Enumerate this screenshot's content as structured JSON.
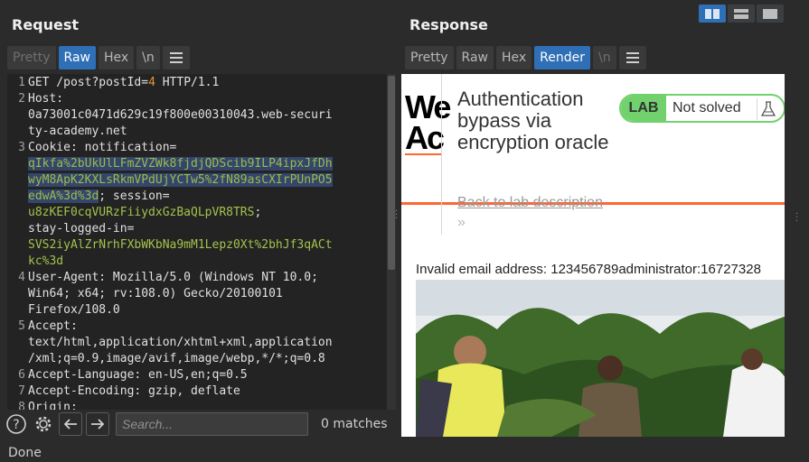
{
  "request": {
    "title": "Request",
    "tabs": [
      {
        "label": "Pretty"
      },
      {
        "label": "Raw"
      },
      {
        "label": "Hex"
      },
      {
        "label": "\\n"
      }
    ],
    "lines": [
      {
        "num": "1",
        "segs": [
          {
            "t": "GET /post?postId=",
            "c": "c-white"
          },
          {
            "t": "4",
            "c": "c-orange"
          },
          {
            "t": " HTTP/1.1",
            "c": "c-white"
          }
        ]
      },
      {
        "num": "2",
        "segs": [
          {
            "t": "Host:",
            "c": "c-white"
          }
        ]
      },
      {
        "num": "",
        "segs": [
          {
            "t": "0a73001c0471d629c19f800e00310043.web-securi",
            "c": "c-white"
          }
        ]
      },
      {
        "num": "",
        "segs": [
          {
            "t": "ty-academy.net",
            "c": "c-white"
          }
        ]
      },
      {
        "num": "3",
        "segs": [
          {
            "t": "Cookie: notification=",
            "c": "c-white"
          }
        ]
      },
      {
        "num": "",
        "segs": [
          {
            "t": "qIkfa%2bUkUlLFmZVZWk8fjdjQDScib9ILP4ipxJfDh",
            "c": "c-sel"
          }
        ]
      },
      {
        "num": "",
        "segs": [
          {
            "t": "wyM8ApK2KXLsRkmVPdUjYCTw5%2fN89asCXIrPUnPO5",
            "c": "c-sel"
          }
        ]
      },
      {
        "num": "",
        "segs": [
          {
            "t": "edwA%3d%3d",
            "c": "c-sel"
          },
          {
            "t": "; session=",
            "c": "c-white"
          }
        ]
      },
      {
        "num": "",
        "segs": [
          {
            "t": "u8zKEF0cqVURzFiiydxGzBaQLpVR8TRS",
            "c": "c-green"
          },
          {
            "t": ";",
            "c": "c-white"
          }
        ]
      },
      {
        "num": "",
        "segs": [
          {
            "t": "stay-logged-in=",
            "c": "c-white"
          }
        ]
      },
      {
        "num": "",
        "segs": [
          {
            "t": "SVS2iyAlZrNrhFXbWKbNa9mM1Lepz0Xt%2bhJf3qACt",
            "c": "c-green"
          }
        ]
      },
      {
        "num": "",
        "segs": [
          {
            "t": "kc%3d",
            "c": "c-green"
          }
        ]
      },
      {
        "num": "4",
        "segs": [
          {
            "t": "User-Agent: Mozilla/5.0 (Windows NT 10.0;",
            "c": "c-white"
          }
        ]
      },
      {
        "num": "",
        "segs": [
          {
            "t": "Win64; x64; rv:108.0) Gecko/20100101",
            "c": "c-white"
          }
        ]
      },
      {
        "num": "",
        "segs": [
          {
            "t": "Firefox/108.0",
            "c": "c-white"
          }
        ]
      },
      {
        "num": "5",
        "segs": [
          {
            "t": "Accept:",
            "c": "c-white"
          }
        ]
      },
      {
        "num": "",
        "segs": [
          {
            "t": "text/html,application/xhtml+xml,application",
            "c": "c-white"
          }
        ]
      },
      {
        "num": "",
        "segs": [
          {
            "t": "/xml;q=0.9,image/avif,image/webp,*/*;q=0.8",
            "c": "c-white"
          }
        ]
      },
      {
        "num": "6",
        "segs": [
          {
            "t": "Accept-Language: en-US,en;q=0.5",
            "c": "c-white"
          }
        ]
      },
      {
        "num": "7",
        "segs": [
          {
            "t": "Accept-Encoding: gzip, deflate",
            "c": "c-white"
          }
        ]
      },
      {
        "num": "8",
        "segs": [
          {
            "t": "Origin:",
            "c": "c-white"
          }
        ]
      }
    ],
    "search_placeholder": "Search...",
    "matches": "0 matches"
  },
  "response": {
    "title": "Response",
    "tabs": [
      {
        "label": "Pretty"
      },
      {
        "label": "Raw"
      },
      {
        "label": "Hex"
      },
      {
        "label": "Render"
      },
      {
        "label": "\\n"
      }
    ],
    "render": {
      "logo": "We\nAc",
      "lab_title": "Authentication bypass via encryption oracle",
      "lab_label": "LAB",
      "lab_status": "Not solved",
      "back_link": "Back to lab description",
      "chevrons": "»",
      "invalid_message": "Invalid email address: 123456789administrator:16727328"
    }
  },
  "status": "Done",
  "icons": [
    "two-pane-icon",
    "stacked-icon",
    "single-pane-icon",
    "menu-icon",
    "help-icon",
    "settings-icon",
    "arrow-left-icon",
    "arrow-right-icon",
    "flask-icon"
  ],
  "colors": {
    "accent": "#2f6fb6",
    "lab_green": "#70d16d",
    "portswigger_orange": "#ff6633"
  }
}
